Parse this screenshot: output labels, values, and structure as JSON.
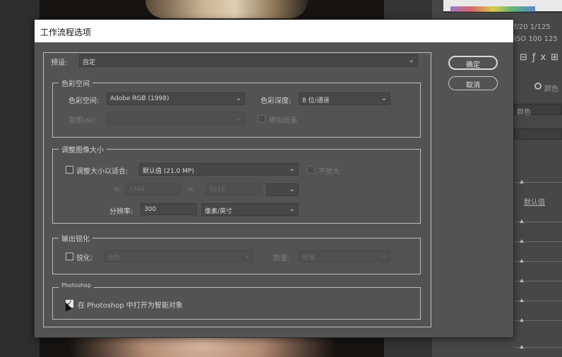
{
  "background": {
    "meta_line1": "f/20   1/125",
    "meta_line2": "ISO 100  125",
    "panel_radio_label": "颜色",
    "panel_select_label": "颜色",
    "panel_default_link": "默认值"
  },
  "dialog": {
    "title": "工作流程选项",
    "preset": {
      "label": "预设:",
      "value": "自定"
    },
    "color_space_group": {
      "title": "色彩空间",
      "space_label": "色彩空间:",
      "space_value": "Adobe RGB (1998)",
      "depth_label": "色彩深度:",
      "depth_value": "8 位/通道",
      "intent_label": "意图(AI):",
      "intent_value": "",
      "simulate_paper_label": "模拟纸墨",
      "simulate_paper_checked": false
    },
    "resize_group": {
      "title": "调整图像大小",
      "fit_label": "调整大小以适合:",
      "fit_checked": false,
      "fit_value": "默认值 (21.0 MP)",
      "dont_enlarge_label": "不放大",
      "dont_enlarge_checked": false,
      "w_label": "W:",
      "w_value": "3744",
      "h_label": "H:",
      "h_value": "5616",
      "unit_value": "",
      "resolution_label": "分辨率:",
      "resolution_value": "300",
      "resolution_unit": "像素/英寸"
    },
    "sharpen_group": {
      "title": "输出锐化",
      "sharpen_label": "锐化:",
      "sharpen_checked": false,
      "sharpen_value": "滤色",
      "amount_label": "数量:",
      "amount_value": "标准"
    },
    "photoshop_group": {
      "title": "Photoshop",
      "smart_object_label": "在 Photoshop 中打开为智能对象",
      "smart_object_checked": true
    },
    "buttons": {
      "ok": "确定",
      "cancel": "取消"
    }
  }
}
